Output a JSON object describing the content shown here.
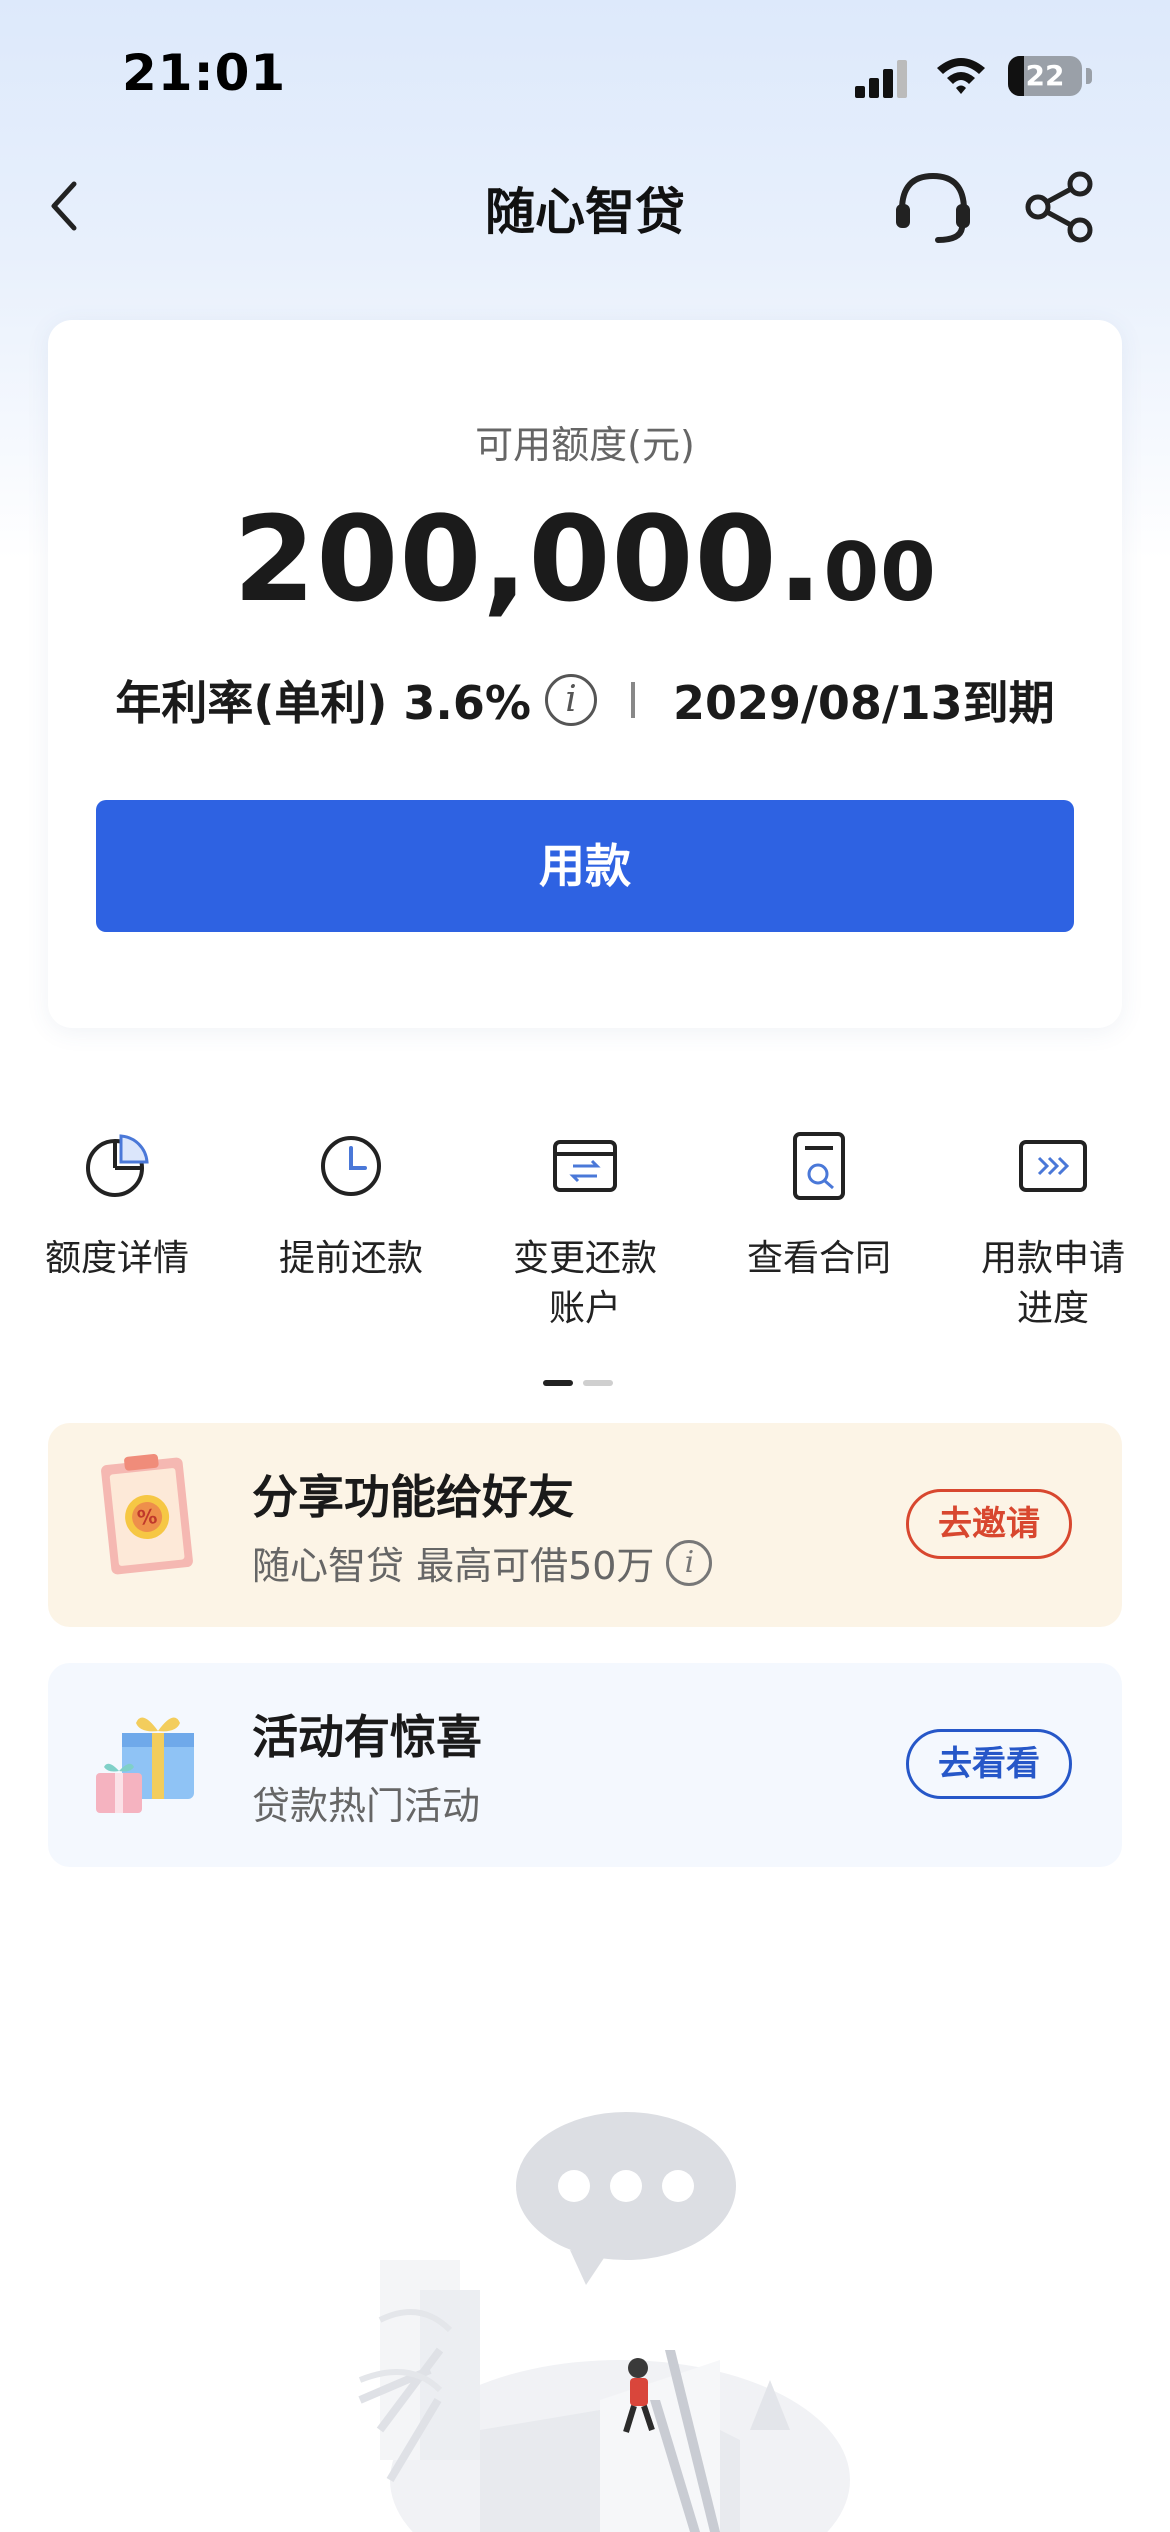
{
  "status_bar": {
    "time": "21:01",
    "battery": "22"
  },
  "nav": {
    "title": "随心智贷"
  },
  "credit": {
    "label": "可用额度(元)",
    "amount_int": "200,000.",
    "amount_dec": "00",
    "rate": "年利率(单利) 3.6%",
    "due": "2029/08/13到期",
    "button_label": "用款"
  },
  "features": [
    {
      "label": "额度详情",
      "icon": "pie-chart-icon"
    },
    {
      "label": "提前还款",
      "icon": "clock-icon"
    },
    {
      "label": "变更还款账户",
      "icon": "card-exchange-icon"
    },
    {
      "label": "查看合同",
      "icon": "document-search-icon"
    },
    {
      "label": "用款申请进度",
      "icon": "progress-arrows-icon"
    }
  ],
  "promos": {
    "invite": {
      "title": "分享功能给好友",
      "subtitle": "随心智贷 最高可借50万",
      "button": "去邀请"
    },
    "activity": {
      "title": "活动有惊喜",
      "subtitle": "贷款热门活动",
      "button": "去看看"
    }
  },
  "colors": {
    "accent": "#2e62e2",
    "invite_red": "#d8472f",
    "view_blue": "#2657c8",
    "invite_bg": "#fcf4e6",
    "activity_bg": "#f4f8fe"
  }
}
